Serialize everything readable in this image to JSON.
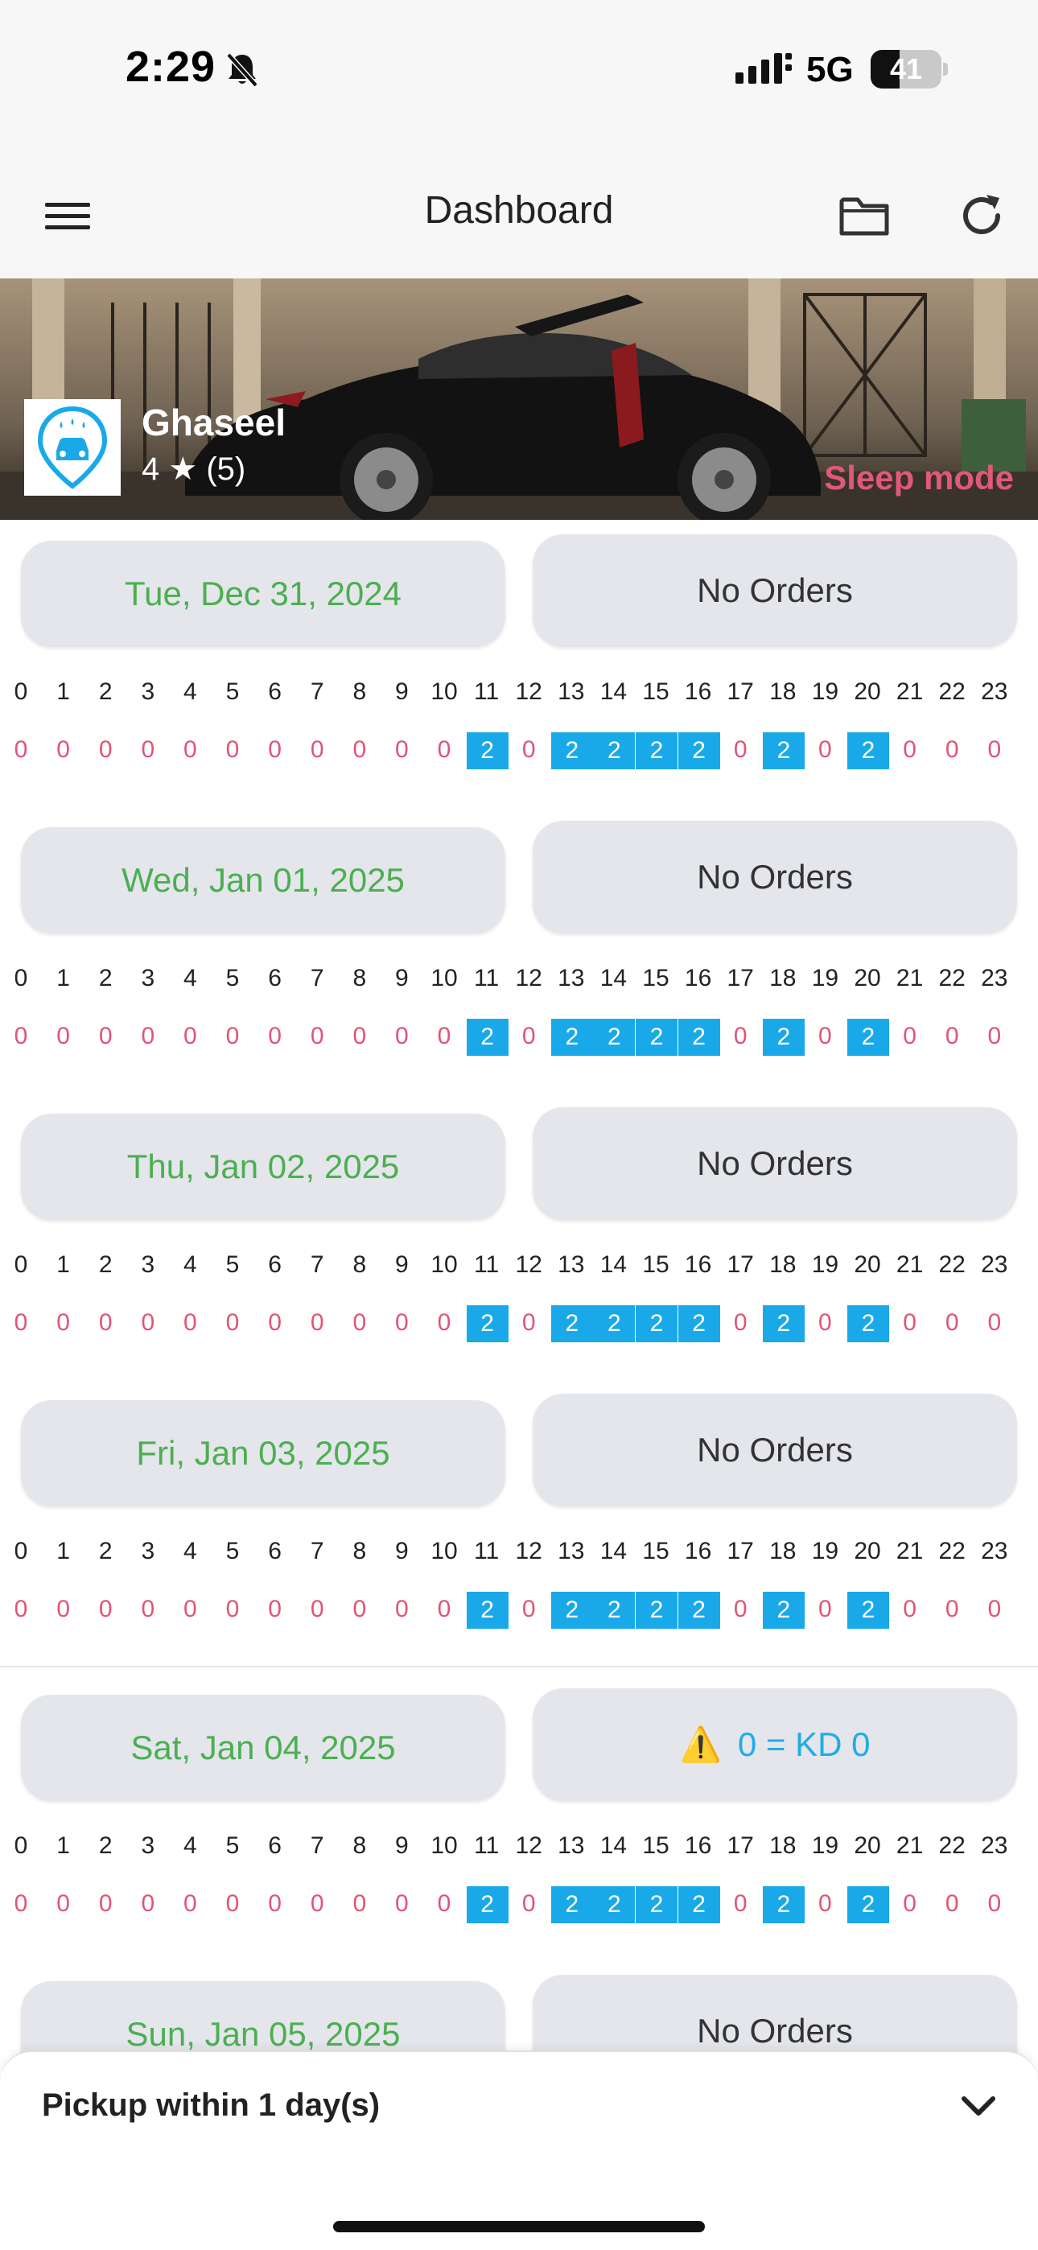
{
  "status_bar": {
    "time": "2:29",
    "network": "5G",
    "battery": "41",
    "battery_level": 0.41,
    "icons": [
      "bell-slash-icon",
      "signal-icon",
      "battery-icon"
    ]
  },
  "app_bar": {
    "title": "Dashboard",
    "icons": [
      "menu-icon",
      "folder-icon",
      "refresh-icon"
    ]
  },
  "store": {
    "name": "Ghaseel",
    "rating": "4 ★ (5)",
    "sleep_mode_label": "Sleep mode",
    "logo_icon": "car-wash-pin-icon"
  },
  "hours": [
    "0",
    "1",
    "2",
    "3",
    "4",
    "5",
    "6",
    "7",
    "8",
    "9",
    "10",
    "11",
    "12",
    "13",
    "14",
    "15",
    "16",
    "17",
    "18",
    "19",
    "20",
    "21",
    "22",
    "23"
  ],
  "days": [
    {
      "date": "Tue, Dec 31, 2024",
      "status": "No Orders",
      "warning": false,
      "counts": [
        "0",
        "0",
        "0",
        "0",
        "0",
        "0",
        "0",
        "0",
        "0",
        "0",
        "0",
        "2",
        "0",
        "2",
        "2",
        "2",
        "2",
        "0",
        "2",
        "0",
        "2",
        "0",
        "0",
        "0"
      ]
    },
    {
      "date": "Wed, Jan 01, 2025",
      "status": "No Orders",
      "warning": false,
      "counts": [
        "0",
        "0",
        "0",
        "0",
        "0",
        "0",
        "0",
        "0",
        "0",
        "0",
        "0",
        "2",
        "0",
        "2",
        "2",
        "2",
        "2",
        "0",
        "2",
        "0",
        "2",
        "0",
        "0",
        "0"
      ]
    },
    {
      "date": "Thu, Jan 02, 2025",
      "status": "No Orders",
      "warning": false,
      "counts": [
        "0",
        "0",
        "0",
        "0",
        "0",
        "0",
        "0",
        "0",
        "0",
        "0",
        "0",
        "2",
        "0",
        "2",
        "2",
        "2",
        "2",
        "0",
        "2",
        "0",
        "2",
        "0",
        "0",
        "0"
      ]
    },
    {
      "date": "Fri, Jan 03, 2025",
      "status": "No Orders",
      "warning": false,
      "counts": [
        "0",
        "0",
        "0",
        "0",
        "0",
        "0",
        "0",
        "0",
        "0",
        "0",
        "0",
        "2",
        "0",
        "2",
        "2",
        "2",
        "2",
        "0",
        "2",
        "0",
        "2",
        "0",
        "0",
        "0"
      ]
    },
    {
      "date": "Sat, Jan 04, 2025",
      "status": "0 = KD 0",
      "warning": true,
      "counts": [
        "0",
        "0",
        "0",
        "0",
        "0",
        "0",
        "0",
        "0",
        "0",
        "0",
        "0",
        "2",
        "0",
        "2",
        "2",
        "2",
        "2",
        "0",
        "2",
        "0",
        "2",
        "0",
        "0",
        "0"
      ]
    },
    {
      "date": "Sun, Jan 05, 2025",
      "status": "No Orders",
      "warning": false,
      "counts": []
    }
  ],
  "bottom_sheet": {
    "label": "Pickup within 1 day(s)",
    "icon": "chevron-down-icon"
  },
  "colors": {
    "date_text": "#4caf50",
    "count_zero": "#e05577",
    "count_active_bg": "#1aa9e8",
    "warning_text": "#1eaee6",
    "sleep_mode": "#e0587a"
  }
}
